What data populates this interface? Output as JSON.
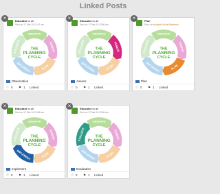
{
  "page": {
    "title": "Linked Posts"
  },
  "cycle": {
    "center_lines": [
      "THE",
      "PLANNING",
      "CYCLE"
    ],
    "segments": [
      "OBSERVE",
      "ASSESS",
      "PLAN",
      "IMPLEMENT",
      "EVALUATE"
    ]
  },
  "colors": {
    "observe": "#b7dd9c",
    "assess": "#e9a9d7",
    "plan": "#f6cfa3",
    "implement": "#b4d5ee",
    "evaluate": "#d1e9cb",
    "center_text": "#4aa832",
    "highlight_assess": "#d4287f",
    "highlight_plan": "#e88b2e",
    "highlight_implement": "#1f5fa8",
    "highlight_evaluate": "#2f9a86"
  },
  "posts": [
    {
      "author": "Educator",
      "audience": "to all",
      "sent": "Sent on 17 Mar 24 13:47 am",
      "tag": "Observation",
      "likes": "0",
      "links": "1",
      "link_label": "Linked",
      "highlight": "observe"
    },
    {
      "author": "Educator",
      "audience": "to all",
      "sent": "Sent on 17 Mar 24 13:56 am",
      "tag": "Assess",
      "likes": "0",
      "links": "1",
      "link_label": "Linked",
      "highlight": "assess"
    },
    {
      "author": "Plan",
      "audience": "",
      "sent": "Plan, for",
      "sent_link": "Analysis Social Relations",
      "tag": "Plan",
      "likes": "0",
      "links": "1",
      "link_label": "Linked",
      "highlight": "plan"
    },
    {
      "author": "Educator",
      "audience": "to all",
      "sent": "Sent on 17 Mar 24 13:56 am",
      "tag": "Implement",
      "likes": "0",
      "links": "1",
      "link_label": "Linked",
      "highlight": "implement"
    },
    {
      "author": "Educator",
      "audience": "to all",
      "sent": "Sent on 17 Mar 24 13:56 am",
      "tag": "Evaluation",
      "likes": "0",
      "links": "1",
      "link_label": "Linked",
      "highlight": "evaluate"
    }
  ],
  "icons": {
    "close": "close-icon",
    "like": "heart-icon",
    "link": "tag-icon",
    "type": "post-type-icon"
  }
}
